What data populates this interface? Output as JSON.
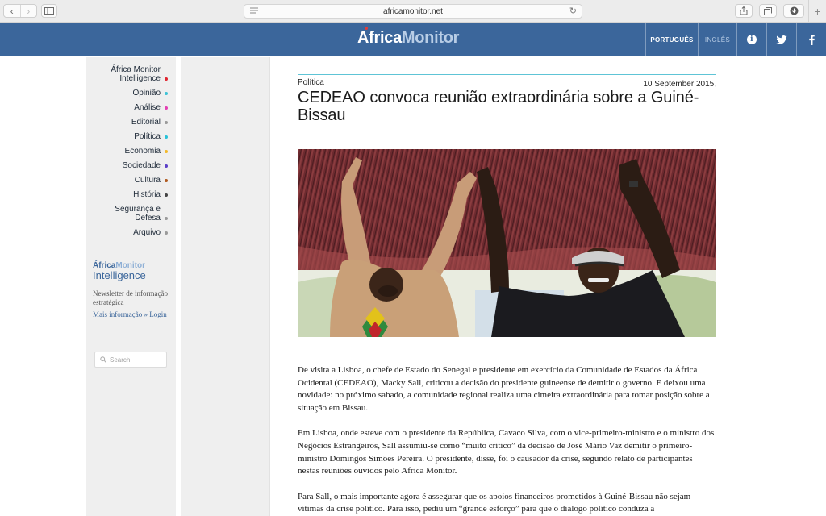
{
  "browser": {
    "url": "africamonitor.net"
  },
  "header": {
    "logo_part1": "Africa",
    "logo_part2": "Monitor",
    "languages": [
      "PORTUGUÊS",
      "INGLÊS"
    ],
    "info_glyph": "i",
    "icons": [
      "info-icon",
      "twitter-icon",
      "facebook-icon"
    ],
    "brand_color": "#3b669b"
  },
  "sidebar": {
    "items": [
      {
        "label": "África Monitor Intelligence",
        "dot": "#e0242f"
      },
      {
        "label": "Opinião",
        "dot": "#3ec3d6"
      },
      {
        "label": "Análise",
        "dot": "#e33fb3"
      },
      {
        "label": "Editorial",
        "dot": "#9a9a9a"
      },
      {
        "label": "Política",
        "dot": "#28c2d8"
      },
      {
        "label": "Economia",
        "dot": "#f2b92c"
      },
      {
        "label": "Sociedade",
        "dot": "#5b3fc7"
      },
      {
        "label": "Cultura",
        "dot": "#b05a1f"
      },
      {
        "label": "História",
        "dot": "#444444"
      },
      {
        "label": "Segurança e Defesa",
        "dot": "#9a9a9a"
      },
      {
        "label": "Arquivo",
        "dot": "#9a9a9a"
      }
    ],
    "intelligence": {
      "logo_a": "África",
      "logo_b": "Monitor",
      "logo_c": "Intelligence",
      "description": "Newsletter de informação estratégica",
      "link": "Mais informação » Login"
    },
    "search_placeholder": "Search"
  },
  "article": {
    "category": "Política",
    "date": "10 September 2015,",
    "title": "CEDEAO convoca reunião extraordinária sobre a Guiné-Bissau",
    "paragraphs": [
      "De visita a Lisboa, o chefe de Estado do Senegal e presidente em exercício da Comunidade de Estados da África Ocidental (CEDEAO), Macky Sall, criticou a decisão do presidente guineense de demitir o governo. E deixou uma novidade: no próximo sabado, a comunidade regional realiza uma cimeira extraordinária para tomar posição sobre a situação em Bissau.",
      "Em Lisboa, onde esteve com o presidente da República, Cavaco Silva, com o vice-primeiro-ministro e o ministro dos Negócios Estrangeiros, Sall assumiu-se como “muito crítico” da decisão de José Mário Vaz demitir o primeiro-ministro Domingos Simões Pereira. O presidente, disse, foi o causador da crise, segundo relato de participantes nestas reuniões ouvidos pelo Africa Monitor.",
      "Para Sall, o mais importante agora é assegurar que os apoios financeiros prometidos à Guiné-Bissau não sejam vítimas da crise político. Para isso, pediu um “grande esforço” para que o diálogo político conduza a"
    ]
  }
}
